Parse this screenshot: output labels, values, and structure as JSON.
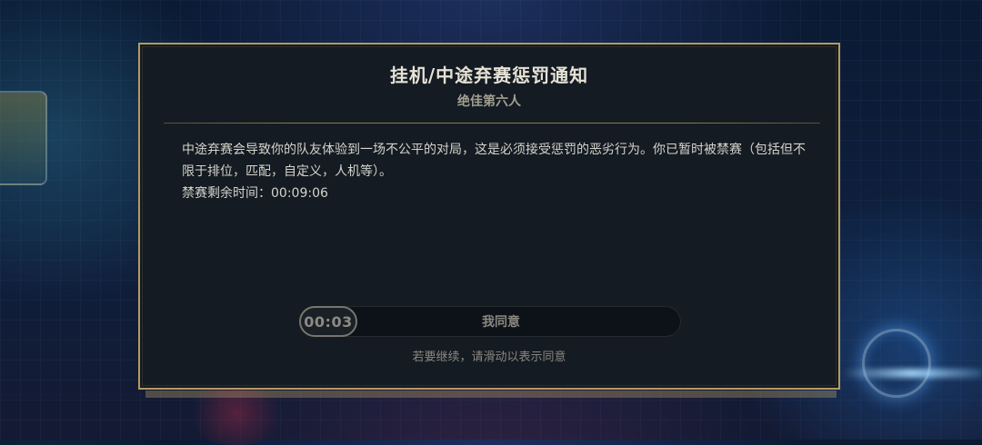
{
  "dialog": {
    "title": "挂机/中途弃赛惩罚通知",
    "subtitle": "绝佳第六人",
    "message": "中途弃赛会导致你的队友体验到一场不公平的对局，这是必须接受惩罚的恶劣行为。你已暂时被禁赛（包括但不限于排位，匹配，自定义，人机等）。",
    "ban_time_label": "禁赛剩余时间：",
    "ban_time_value": "00:09:06",
    "slider": {
      "countdown": "00:03",
      "label": "我同意"
    },
    "hint": "若要继续，请滑动以表示同意"
  },
  "colors": {
    "frame_gold": "#b49a62",
    "panel_bg": "#141b22",
    "title_text": "#e6e2d6"
  }
}
